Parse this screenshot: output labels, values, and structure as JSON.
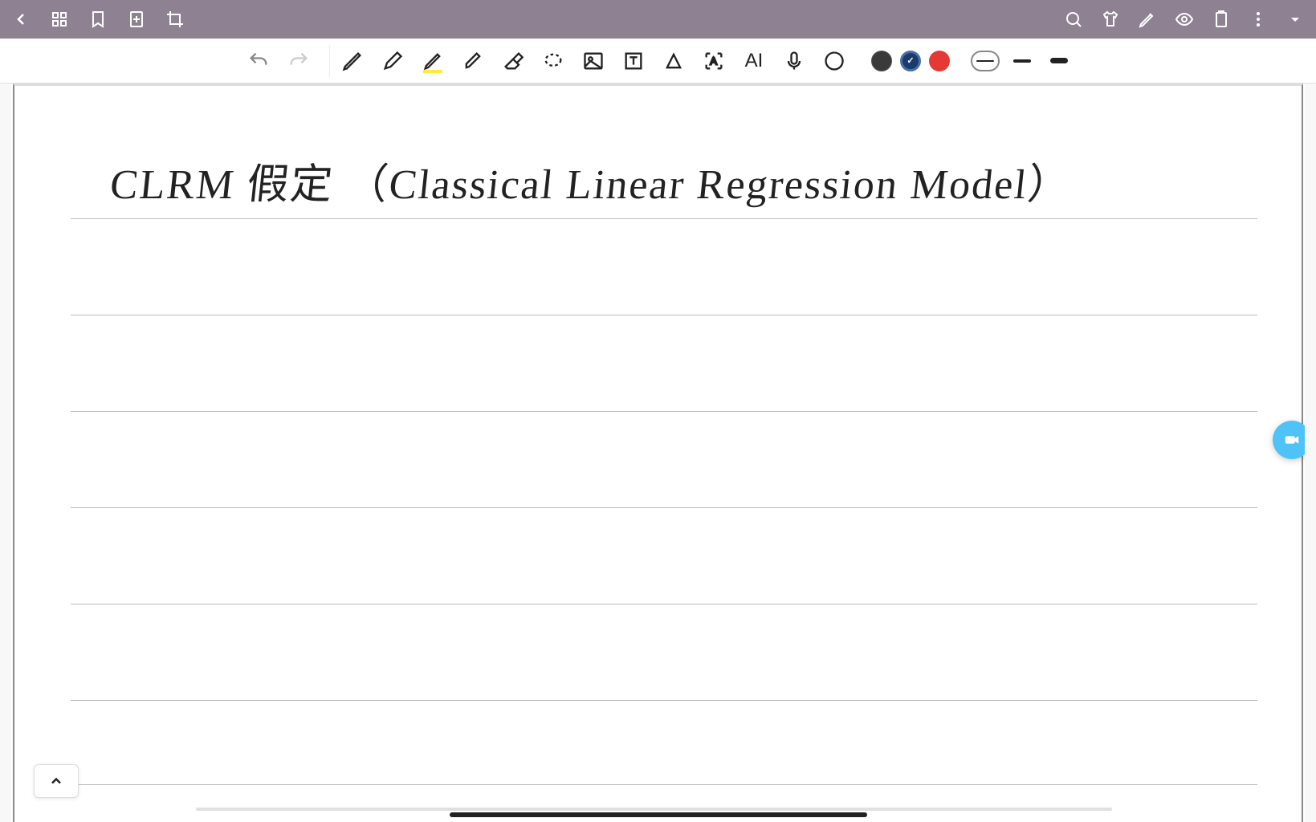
{
  "topbar": {
    "icons_left": [
      "back",
      "apps",
      "bookmark",
      "add-page",
      "crop"
    ],
    "icons_right": [
      "search",
      "t-shirt",
      "pen-edit",
      "eye",
      "paste",
      "more",
      "dropdown"
    ]
  },
  "toolbar": {
    "history": {
      "undo": "undo",
      "redo": "redo"
    },
    "tools": {
      "pen": "pen",
      "pencil": "pencil",
      "highlighter": "highlighter",
      "marker": "marker",
      "eraser": "eraser",
      "lasso": "lasso",
      "image": "image",
      "text": "text",
      "shape": "shape",
      "ocr": "ocr",
      "ai_label": "AI",
      "mic": "mic",
      "crop": "crop"
    },
    "colors": {
      "black": "#3a3a3a",
      "navy": "#1a3b6e",
      "red": "#e53935",
      "selected": "navy"
    },
    "strokes": {
      "thin": 2,
      "medium": 4,
      "thick": 7,
      "selected": "thin"
    }
  },
  "note": {
    "title_text": "CLRM 假定   （Classical  Linear  Regression  Model）"
  },
  "controls": {
    "expand": "expand",
    "camera": "camera"
  }
}
